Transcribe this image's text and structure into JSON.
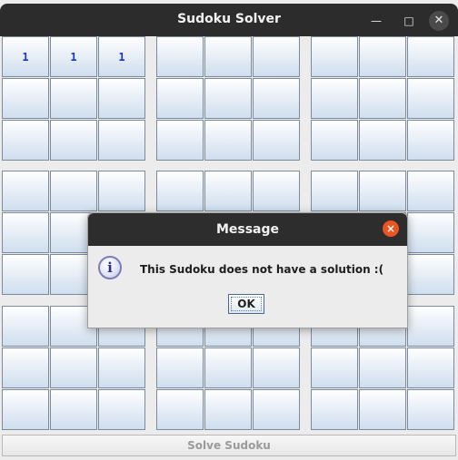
{
  "window": {
    "title": "Sudoku Solver",
    "minimize_icon": "minimize-icon",
    "maximize_icon": "maximize-icon",
    "close_icon": "close-icon"
  },
  "board": {
    "rows": [
      [
        "1",
        "1",
        "1",
        "",
        "",
        "",
        "",
        "",
        ""
      ],
      [
        "",
        "",
        "",
        "",
        "",
        "",
        "",
        "",
        ""
      ],
      [
        "",
        "",
        "",
        "",
        "",
        "",
        "",
        "",
        ""
      ],
      [
        "",
        "",
        "",
        "",
        "",
        "",
        "",
        "",
        ""
      ],
      [
        "",
        "",
        "",
        "",
        "",
        "",
        "",
        "",
        ""
      ],
      [
        "",
        "",
        "",
        "",
        "",
        "",
        "",
        "",
        ""
      ],
      [
        "",
        "",
        "",
        "",
        "",
        "",
        "",
        "",
        ""
      ],
      [
        "",
        "",
        "",
        "",
        "",
        "",
        "",
        "",
        ""
      ],
      [
        "",
        "",
        "",
        "",
        "",
        "",
        "",
        "",
        ""
      ]
    ],
    "digit_color": "#1a33d6"
  },
  "solve_button": {
    "label": "Solve Sudoku"
  },
  "dialog": {
    "title": "Message",
    "message": "This Sudoku does not have a solution :(",
    "ok_label": "OK",
    "icon": "info-icon",
    "close_color": "#e95420"
  }
}
